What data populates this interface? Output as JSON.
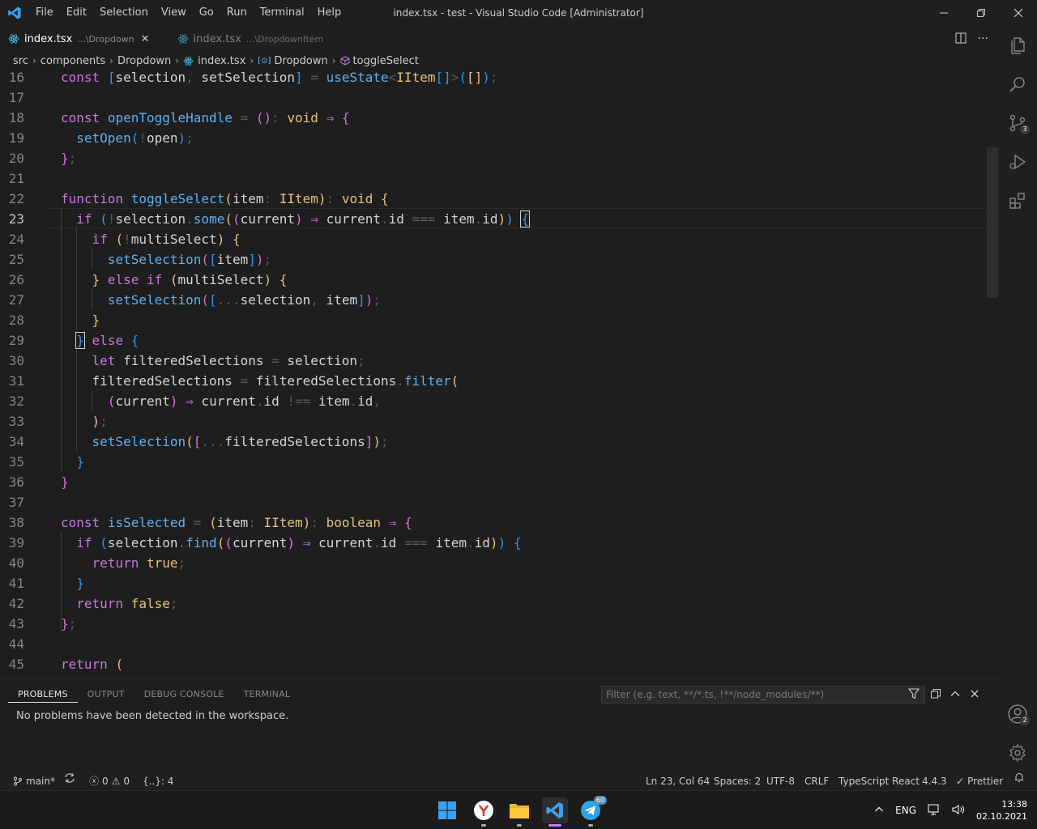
{
  "window": {
    "title": "index.tsx - test - Visual Studio Code [Administrator]",
    "menu": [
      "File",
      "Edit",
      "Selection",
      "View",
      "Go",
      "Run",
      "Terminal",
      "Help"
    ]
  },
  "tabs": [
    {
      "label": "index.tsx",
      "description": "...\\Dropdown",
      "active": true
    },
    {
      "label": "index.tsx",
      "description": "...\\DropdownItem",
      "active": false
    }
  ],
  "breadcrumb": [
    "src",
    "components",
    "Dropdown",
    "index.tsx",
    "Dropdown",
    "toggleSelect"
  ],
  "editor": {
    "line_numbers": [
      "16",
      "17",
      "18",
      "19",
      "20",
      "21",
      "22",
      "23",
      "24",
      "25",
      "26",
      "27",
      "28",
      "29",
      "30",
      "31",
      "32",
      "33",
      "34",
      "35",
      "36",
      "37",
      "38",
      "39",
      "40",
      "41",
      "42",
      "43",
      "44",
      "45"
    ],
    "current_line": "23"
  },
  "panel": {
    "tabs": [
      "PROBLEMS",
      "OUTPUT",
      "DEBUG CONSOLE",
      "TERMINAL"
    ],
    "filter_placeholder": "Filter (e.g. text, **/*.ts, !**/node_modules/**)",
    "message": "No problems have been detected in the workspace."
  },
  "activity_bar": {
    "scm_badge": "3",
    "accounts_badge": "2"
  },
  "statusbar": {
    "branch": "main*",
    "errors": "0",
    "warnings": "0",
    "brackets": "{..}: 4",
    "position": "Ln 23, Col 64",
    "spaces": "Spaces: 2",
    "encoding": "UTF-8",
    "eol": "CRLF",
    "language": "TypeScript React",
    "version": "4.4.3",
    "formatter": "Prettier"
  },
  "taskbar": {
    "telegram_badge": "60",
    "language": "ENG",
    "time": "13:38",
    "date": "02.10.2021"
  },
  "colors": {
    "background": "#1e1e1e",
    "keyword": "#c678dd",
    "function": "#61afef",
    "type": "#e5c07b",
    "accent": "#007acc"
  }
}
